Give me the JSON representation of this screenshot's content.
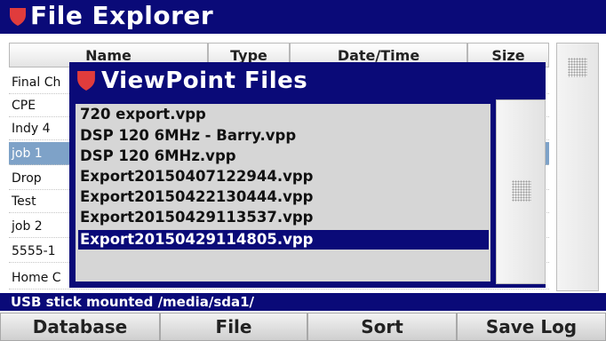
{
  "app": {
    "title": "File Explorer",
    "accent_color": "#0a0a78",
    "shield_color": "#e03c3c",
    "logo_icon": "shield-icon"
  },
  "table": {
    "columns": [
      "Name",
      "Type",
      "Date/Time",
      "Size"
    ],
    "rows": [
      "Final Ch",
      "CPE",
      "Indy 4",
      "job 1",
      "Drop",
      "Test",
      "job 2",
      "5555-1",
      "Home C"
    ],
    "selected_index": 3
  },
  "dialog": {
    "title": "ViewPoint Files",
    "files": [
      "720 export.vpp",
      "DSP 120 6MHz - Barry.vpp",
      "DSP 120 6MHz.vpp",
      "Export20150407122944.vpp",
      "Export20150422130444.vpp",
      "Export20150429113537.vpp",
      "Export20150429114805.vpp"
    ],
    "selected_index": 6
  },
  "status": {
    "text": "USB stick mounted /media/sda1/"
  },
  "buttons": {
    "database": "Database",
    "file": "File",
    "sort": "Sort",
    "save_log": "Save Log"
  }
}
